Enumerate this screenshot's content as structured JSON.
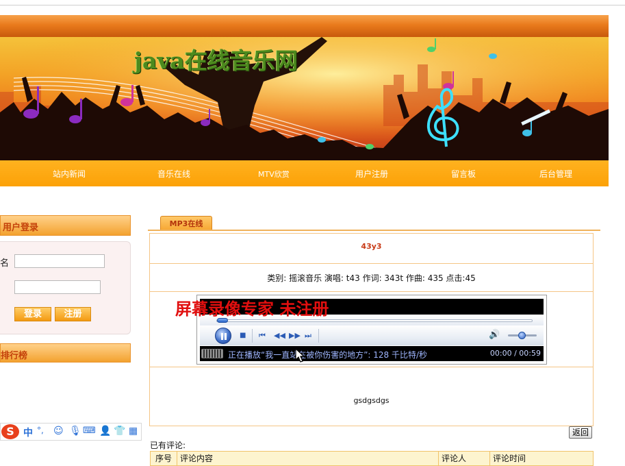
{
  "site": {
    "title": "java在线音乐网"
  },
  "nav": [
    {
      "label": "站内新闻"
    },
    {
      "label": "音乐在线"
    },
    {
      "label": "MTV欣赏"
    },
    {
      "label": "用户注册"
    },
    {
      "label": "留言板"
    },
    {
      "label": "后台管理"
    }
  ],
  "login": {
    "title": "用户登录",
    "username_label": "名",
    "username_value": "",
    "password_value": "",
    "login_button": "登录",
    "register_button": "注册"
  },
  "ranking": {
    "title": "排行榜"
  },
  "ime": {
    "logo": "S",
    "lang": "中",
    "punct": "°,",
    "icons": [
      "smiley-icon",
      "microphone-icon",
      "keyboard-icon",
      "user-icon",
      "shirt-icon",
      "grid-icon"
    ]
  },
  "main": {
    "tab": "MP3在线",
    "song_title": "43y3",
    "song_info": "类别: 摇滚音乐 演唱: t43 作词: 343t 作曲: 435 点击:45",
    "song_desc": "gsdgsdgs",
    "back_button": "返回",
    "comments_label": "已有评论:"
  },
  "player": {
    "status_text": "正在播放“我一直站在被你伤害的地方”: 128 千比特/秒",
    "time": "00:00 / 00:59",
    "progress": 0.0
  },
  "watermark": "屏幕录像专家  未注册",
  "comments_table": {
    "headers": [
      "序号",
      "评论内容",
      "评论人",
      "评论时间"
    ]
  },
  "colors": {
    "nav": "#fca107",
    "accent": "#c4410a",
    "title_green": "#4d8a1e",
    "watermark": "#e10f0f"
  }
}
